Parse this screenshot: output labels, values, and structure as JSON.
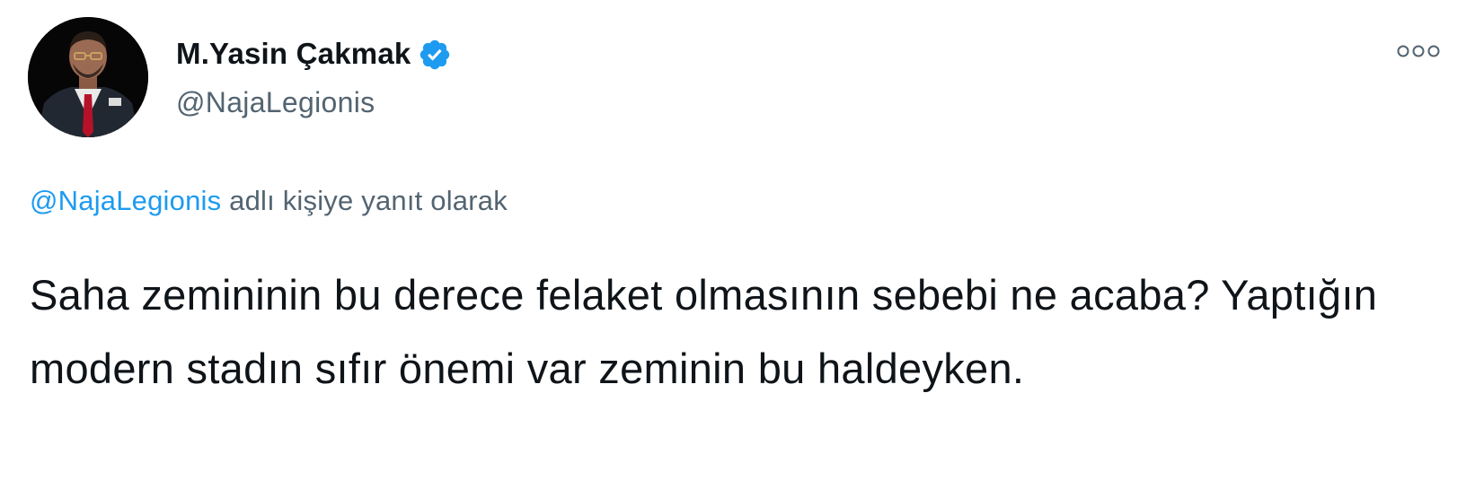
{
  "author": {
    "display_name": "M.Yasin Çakmak",
    "handle": "@NajaLegionis",
    "verified": true
  },
  "reply_context": {
    "mention": "@NajaLegionis",
    "suffix": " adlı kişiye yanıt olarak"
  },
  "tweet": {
    "text": "Saha zemininin bu derece felaket olmasının sebebi ne acaba? Yaptığın modern stadın sıfır önemi var zeminin bu haldeyken."
  },
  "icons": {
    "verified": "verified-badge-icon",
    "more": "more-options-icon"
  },
  "colors": {
    "accent": "#1d9bf0",
    "text": "#0f1419",
    "secondary": "#536471"
  }
}
